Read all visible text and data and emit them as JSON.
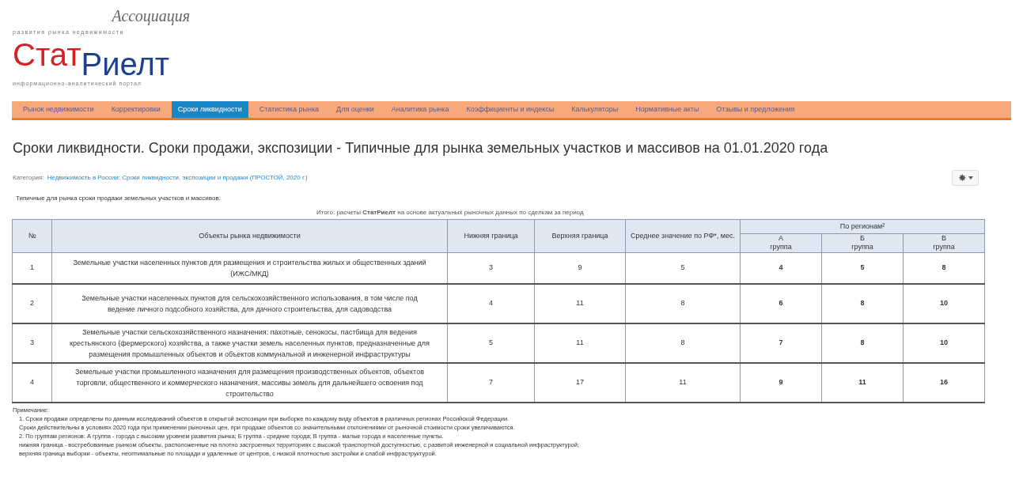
{
  "logo": {
    "association": "Ассоциация",
    "tagline_top": "развития рынка недвижимости",
    "brand_first": "Стат",
    "brand_second": "Риелт",
    "tagline_bottom": "информационно-аналитический портал"
  },
  "nav": [
    {
      "label": "Рынок недвижимости",
      "selected": false
    },
    {
      "label": "Корректировки",
      "selected": false
    },
    {
      "label": "Сроки ликвидности",
      "selected": true
    },
    {
      "label": "Статистика рынка",
      "selected": false
    },
    {
      "label": "Для оценки",
      "selected": false
    },
    {
      "label": "Аналитика рынка",
      "selected": false
    },
    {
      "label": "Коэффициенты и индексы",
      "selected": false
    },
    {
      "label": "Калькуляторы",
      "selected": false
    },
    {
      "label": "Нормативные акты",
      "selected": false
    },
    {
      "label": "Отзывы и предложения",
      "selected": false
    }
  ],
  "title": "Сроки ликвидности. Сроки продажи, экспозиции - Типичные для рынка земельных участков и массивов на 01.01.2020 года",
  "category": {
    "label": "Категория:",
    "link": "Недвижимость в России: Сроки ликвидности, экспозиции и продажи (ПРОСТОЙ, 2020 г.)"
  },
  "subtitle": "Типичные для рынка сроки продажи земельных участков и массивов:",
  "table": {
    "caption": "Итого: расчеты **СтатРиелт** на основе актуальных рыночных данных по сделкам за период",
    "headers": {
      "number": "№",
      "object": "Объекты рынка недвижимости",
      "lower": "Нижняя граница",
      "upper": "Верхняя граница",
      "average": "Среднее значение по РФ*, мес.",
      "regions": "По регионам²"
    },
    "groups": [
      {
        "letter": "А",
        "word": "группа"
      },
      {
        "letter": "Б",
        "word": "группа"
      },
      {
        "letter": "В",
        "word": "группа"
      }
    ],
    "rows": [
      {
        "number": "1",
        "object": "Земельные участки населенных пунктов для размещения и строительства жилых и общественных зданий (ИЖС/МКД)",
        "lower": "3",
        "upper": "9",
        "average": "5",
        "groups": [
          "4",
          "5",
          "8"
        ]
      },
      {
        "number": "2",
        "object": "Земельные участки населенных пунктов для сельскохозяйственного использования, в том числе под ведение личного подсобного хозяйства, для дачного строительства, для садоводства",
        "lower": "4",
        "upper": "11",
        "average": "8",
        "groups": [
          "6",
          "8",
          "10"
        ]
      },
      {
        "number": "3",
        "object": "Земельные участки сельскохозяйственного назначения: пахотные, сенокосы, пастбища для ведения крестьянского (фермерского) хозяйства, а также участки земель населенных пунктов, предназначенные для размещения промышленных объектов и объектов коммунальной и инженерной инфраструктуры",
        "lower": "5",
        "upper": "11",
        "average": "8",
        "groups": [
          "7",
          "8",
          "10"
        ]
      },
      {
        "number": "4",
        "object": "Земельные участки промышленного назначения для размещения производственных объектов, объектов торговли, общественного и коммерческого назначения, массивы земель для дальнейшего освоения под строительство",
        "lower": "7",
        "upper": "17",
        "average": "11",
        "groups": [
          "9",
          "11",
          "16"
        ]
      }
    ]
  },
  "notes": {
    "heading": "Примечание:",
    "items": [
      "1. Сроки продажи определены по данным исследований объектов в открытой экспозиции при выборке по каждому виду объектов в различных регионах Российской Федерации.",
      "Сроки действительны в условиях 2020 года при применении рыночных цен, при продаже объектов со значительными отклонениями от рыночной стоимости сроки увеличиваются.",
      "2. По группам регионов: А группа - города с высоким уровнем развития рынка; Б группа - средние города; В группа - малые города и населенные пункты.",
      "нижняя граница - востребованные рынком объекты, расположенные на плотно застроенных территориях с высокой транспортной доступностью, с развитой инженерной и социальной инфраструктурой;",
      "верхняя граница выборки - объекты, неоптимальные по площади и удаленные от центров, с низкой плотностью застройки и слабой инфраструктурой."
    ]
  }
}
